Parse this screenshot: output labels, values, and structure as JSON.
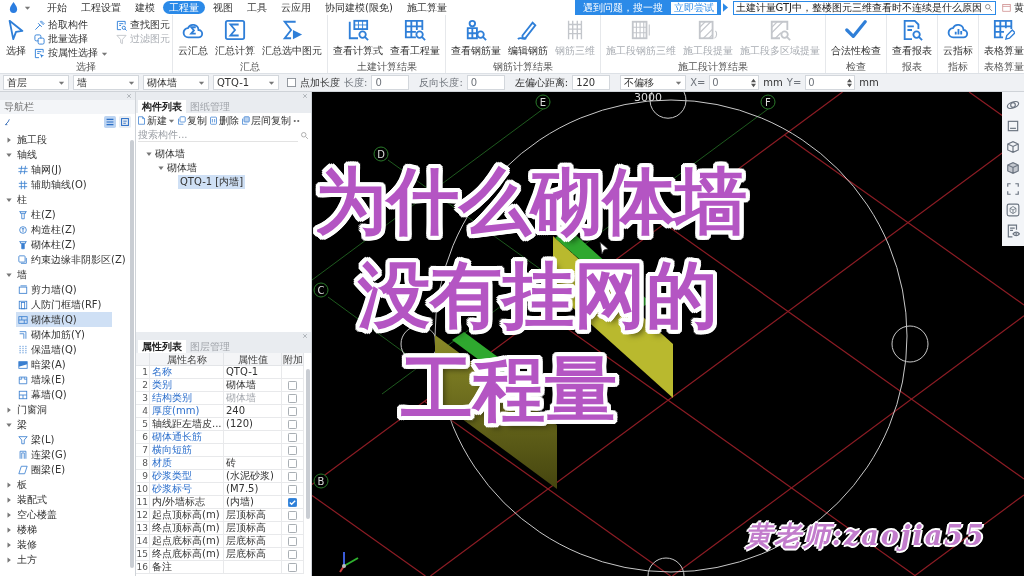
{
  "menu_tabs": [
    {
      "label": "开始",
      "selected": false
    },
    {
      "label": "工程设置",
      "selected": false
    },
    {
      "label": "建模",
      "selected": false
    },
    {
      "label": "工程量",
      "selected": true
    },
    {
      "label": "视图",
      "selected": false
    },
    {
      "label": "工具",
      "selected": false
    },
    {
      "label": "云应用",
      "selected": false
    },
    {
      "label": "协同建模(限免)",
      "selected": false
    },
    {
      "label": "施工算量",
      "selected": false
    }
  ],
  "help_popup": {
    "text": "遇到问题，搜一搜",
    "button": "立即尝试"
  },
  "help_search": {
    "value": "土建计量GTJ中，整楼图元三维查看时不连续是什么原因"
  },
  "user": {
    "name": "黄"
  },
  "ribbon": [
    {
      "label": "选择",
      "buttons": [
        {
          "label": "选择",
          "kind": "large",
          "disabled": false
        },
        {
          "label": "拾取构件",
          "kind": "small",
          "disabled": false
        },
        {
          "label": "批量选择",
          "kind": "small",
          "disabled": false
        },
        {
          "label": "按属性选择",
          "kind": "small-menu",
          "disabled": false
        },
        {
          "label": "查找图元",
          "kind": "small",
          "disabled": false
        },
        {
          "label": "过滤图元",
          "kind": "small",
          "disabled": true
        }
      ]
    },
    {
      "label": "汇总",
      "buttons": [
        {
          "label": "云汇总",
          "kind": "large",
          "disabled": false
        },
        {
          "label": "汇总计算",
          "kind": "large",
          "disabled": false
        },
        {
          "label": "汇总选中图元",
          "kind": "large",
          "disabled": false
        }
      ]
    },
    {
      "label": "土建计算结果",
      "buttons": [
        {
          "label": "查看计算式",
          "kind": "large",
          "disabled": false
        },
        {
          "label": "查看工程量",
          "kind": "large",
          "disabled": false
        }
      ]
    },
    {
      "label": "钢筋计算结果",
      "buttons": [
        {
          "label": "查看钢筋量",
          "kind": "large",
          "disabled": false
        },
        {
          "label": "编辑钢筋",
          "kind": "large",
          "disabled": false
        },
        {
          "label": "钢筋三维",
          "kind": "large",
          "disabled": true
        }
      ]
    },
    {
      "label": "施工段计算结果",
      "buttons": [
        {
          "label": "施工段钢筋三维",
          "kind": "large",
          "disabled": true
        },
        {
          "label": "施工段提量",
          "kind": "large",
          "disabled": true
        },
        {
          "label": "施工段多区域提量",
          "kind": "large",
          "disabled": true
        }
      ]
    },
    {
      "label": "检查",
      "buttons": [
        {
          "label": "合法性检查",
          "kind": "large",
          "disabled": false
        }
      ]
    },
    {
      "label": "报表",
      "buttons": [
        {
          "label": "查看报表",
          "kind": "large",
          "disabled": false
        }
      ]
    },
    {
      "label": "指标",
      "buttons": [
        {
          "label": "云指标",
          "kind": "large",
          "disabled": false
        }
      ]
    },
    {
      "label": "表格算量",
      "buttons": [
        {
          "label": "表格算量",
          "kind": "large",
          "disabled": false
        }
      ]
    }
  ],
  "toolbar": [
    {
      "kind": "dropdown",
      "value": "首层"
    },
    {
      "kind": "dropdown",
      "value": "墙"
    },
    {
      "kind": "dropdown",
      "value": "砌体墙"
    },
    {
      "kind": "dropdown",
      "value": "QTQ-1"
    },
    {
      "kind": "checkbox",
      "label": "点加长度",
      "checked": false
    },
    {
      "kind": "field",
      "label": "长度:",
      "value": "0",
      "disabled": true
    },
    {
      "kind": "field",
      "label": "反向长度:",
      "value": "0",
      "disabled": true
    },
    {
      "kind": "field",
      "label": "左偏心距离:",
      "value": "120",
      "disabled": false
    },
    {
      "kind": "dropdown",
      "value": "不偏移"
    },
    {
      "kind": "spin",
      "label": "X=",
      "value": "0",
      "unit": "mm"
    },
    {
      "kind": "spin",
      "label": "Y=",
      "value": "0",
      "unit": "mm"
    }
  ],
  "nav": {
    "title": "导航栏",
    "views": [
      {
        "selected": true
      },
      {
        "selected": false
      }
    ],
    "items": [
      {
        "label": "施工段",
        "expanded": false
      },
      {
        "label": "轴线",
        "expanded": true,
        "children": [
          {
            "label": "轴网(J)",
            "selected": false
          },
          {
            "label": "辅助轴线(O)",
            "selected": false
          }
        ]
      },
      {
        "label": "柱",
        "expanded": true,
        "children": [
          {
            "label": "柱(Z)",
            "selected": false
          },
          {
            "label": "构造柱(Z)",
            "selected": false
          },
          {
            "label": "砌体柱(Z)",
            "selected": false
          },
          {
            "label": "约束边缘非阴影区(Z)",
            "selected": false
          }
        ]
      },
      {
        "label": "墙",
        "expanded": true,
        "children": [
          {
            "label": "剪力墙(Q)",
            "selected": false
          },
          {
            "label": "人防门框墙(RF)",
            "selected": false
          },
          {
            "label": "砌体墙(Q)",
            "selected": true
          },
          {
            "label": "砌体加筋(Y)",
            "selected": false
          },
          {
            "label": "保温墙(Q)",
            "selected": false
          },
          {
            "label": "暗梁(A)",
            "selected": false
          },
          {
            "label": "墙垛(E)",
            "selected": false
          },
          {
            "label": "幕墙(Q)",
            "selected": false
          }
        ]
      },
      {
        "label": "门窗洞",
        "expanded": false
      },
      {
        "label": "梁",
        "expanded": true,
        "children": [
          {
            "label": "梁(L)",
            "selected": false
          },
          {
            "label": "连梁(G)",
            "selected": false
          },
          {
            "label": "圈梁(E)",
            "selected": false
          }
        ]
      },
      {
        "label": "板",
        "expanded": false
      },
      {
        "label": "装配式",
        "expanded": false
      },
      {
        "label": "空心楼盖",
        "expanded": false
      },
      {
        "label": "楼梯",
        "expanded": false
      },
      {
        "label": "装修",
        "expanded": false
      },
      {
        "label": "土方",
        "expanded": false
      }
    ]
  },
  "component_panel": {
    "tabs": [
      {
        "label": "构件列表",
        "selected": true
      },
      {
        "label": "图纸管理",
        "selected": false
      }
    ],
    "actions": [
      {
        "label": "新建",
        "kind": "menu"
      },
      {
        "label": "复制",
        "kind": "button"
      },
      {
        "label": "删除",
        "kind": "button"
      },
      {
        "label": "层间复制",
        "kind": "button"
      }
    ],
    "search": {
      "placeholder": "搜索构件..."
    },
    "tree": [
      {
        "label": "砌体墙",
        "expanded": true,
        "selected": false,
        "children": [
          {
            "label": "砌体墙",
            "expanded": true,
            "selected": false,
            "children": [
              {
                "label": "QTQ-1 [内墙]",
                "selected": true
              }
            ]
          }
        ]
      }
    ]
  },
  "property_panel": {
    "tabs": [
      {
        "label": "属性列表",
        "selected": true
      },
      {
        "label": "图层管理",
        "selected": false
      }
    ],
    "columns": [
      "属性名称",
      "属性值",
      "附加"
    ],
    "rows": [
      {
        "index": "1",
        "name": "名称",
        "value": "QTQ-1",
        "public": true,
        "readonly": false
      },
      {
        "index": "2",
        "name": "类别",
        "value": "砌体墙",
        "public": true,
        "readonly": false,
        "checked": false
      },
      {
        "index": "3",
        "name": "结构类别",
        "value": "砌体墙",
        "public": true,
        "readonly": true,
        "checked": false
      },
      {
        "index": "4",
        "name": "厚度(mm)",
        "value": "240",
        "public": true,
        "readonly": false,
        "checked": false
      },
      {
        "index": "5",
        "name": "轴线距左墙皮...",
        "value": "(120)",
        "public": false,
        "readonly": false,
        "checked": false
      },
      {
        "index": "6",
        "name": "砌体通长筋",
        "public": true,
        "checked": false
      },
      {
        "index": "7",
        "name": "横向短筋",
        "public": true,
        "checked": false
      },
      {
        "index": "8",
        "name": "材质",
        "value": "砖",
        "public": true,
        "readonly": false,
        "checked": false
      },
      {
        "index": "9",
        "name": "砂浆类型",
        "value": "(水泥砂浆)",
        "public": true,
        "readonly": false,
        "checked": false
      },
      {
        "index": "10",
        "name": "砂浆标号",
        "value": "(M7.5)",
        "public": true,
        "readonly": false,
        "checked": false
      },
      {
        "index": "11",
        "name": "内/外墙标志",
        "value": "(内墙)",
        "public": false,
        "readonly": false,
        "checked": true
      },
      {
        "index": "12",
        "name": "起点顶标高(m)",
        "value": "层顶标高",
        "public": false,
        "readonly": false,
        "checked": false
      },
      {
        "index": "13",
        "name": "终点顶标高(m)",
        "value": "层顶标高",
        "public": false,
        "readonly": false,
        "checked": false
      },
      {
        "index": "14",
        "name": "起点底标高(m)",
        "value": "层底标高",
        "public": false,
        "readonly": false,
        "checked": false
      },
      {
        "index": "15",
        "name": "终点底标高(m)",
        "value": "层底标高",
        "public": false,
        "readonly": false,
        "checked": false
      },
      {
        "index": "16",
        "name": "备注",
        "public": false,
        "checked": false
      }
    ]
  },
  "canvas": {
    "dimension": "3000",
    "axis_labels": [
      {
        "label": "E"
      },
      {
        "label": "F"
      },
      {
        "label": "D"
      },
      {
        "label": "C"
      },
      {
        "label": "B"
      }
    ]
  },
  "overlay": {
    "title_lines": [
      "为什么砌体墙",
      "没有挂网的",
      "工程量"
    ],
    "signature": "黄老师:zaojia55"
  }
}
